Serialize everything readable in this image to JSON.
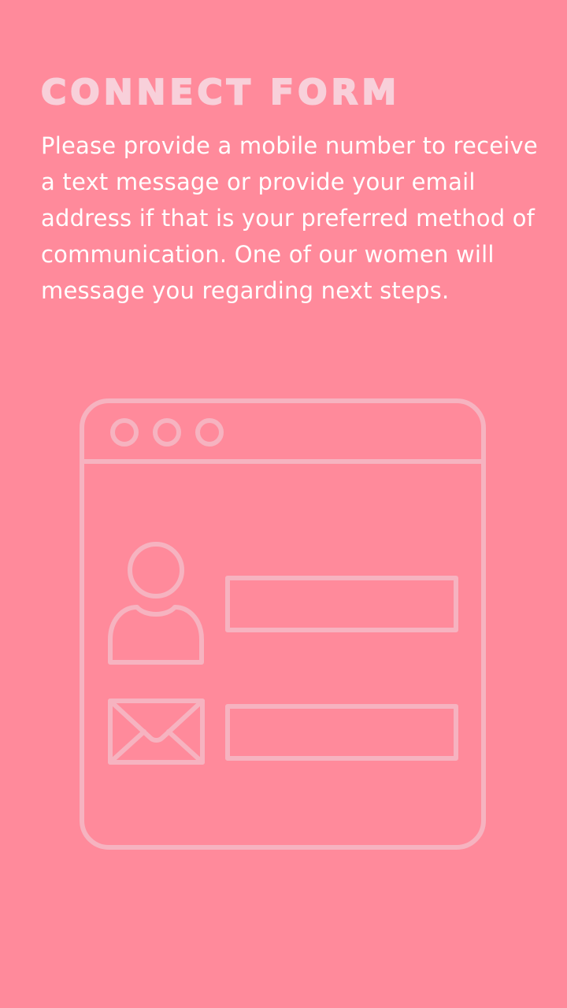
{
  "title": "Connect Form",
  "description": "Please provide a mobile number to receive a text message or provide your email address if that is your preferred method of communication. One of our women will message you regarding next steps.",
  "illustration": {
    "window_dots_icon": "window-dots-icon",
    "person_icon": "person-icon",
    "envelope_icon": "envelope-icon",
    "line_color": "#F6B3C0"
  },
  "colors": {
    "background": "#FF8A9B",
    "title": "#F8D0DA",
    "text": "#FFFFFF"
  }
}
